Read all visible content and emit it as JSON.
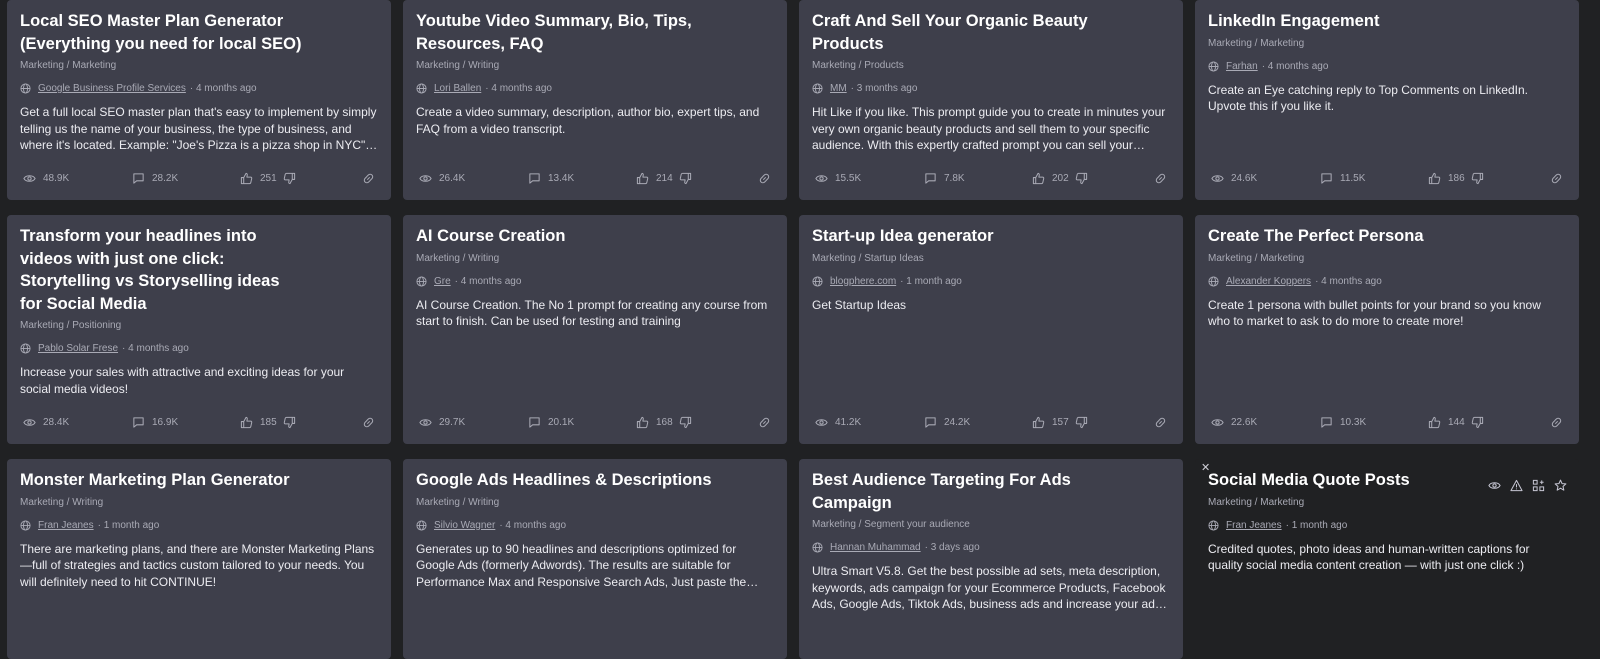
{
  "cards": [
    {
      "title": "Local SEO Master Plan Generator (Everything you need for local SEO)",
      "category": "Marketing / Marketing",
      "author": "Google Business Profile Services",
      "ago": "· 4 months ago",
      "description": "Get a full local SEO master plan that's easy to implement by simply telling us the name of your business, the type of business, and where it's located. Example: \"Joe's Pizza is a pizza shop in NYC\". The master SEO…",
      "views": "48.9K",
      "comments": "28.2K",
      "likes": "251"
    },
    {
      "title": "Youtube Video Summary, Bio, Tips, Resources, FAQ",
      "category": "Marketing / Writing",
      "author": "Lori Ballen",
      "ago": "· 4 months ago",
      "description": "Create a video summary, description, author bio, expert tips, and FAQ from a video transcript.",
      "views": "26.4K",
      "comments": "13.4K",
      "likes": "214"
    },
    {
      "title": "Craft And Sell Your Organic Beauty Products",
      "category": "Marketing / Products",
      "author": "MM",
      "ago": "· 3 months ago",
      "description": "Hit Like if you like. This prompt guide you to create in minutes your very own organic beauty products and sell them to your specific audience. With this expertly crafted prompt you can sell your luxurious skincare,…",
      "views": "15.5K",
      "comments": "7.8K",
      "likes": "202"
    },
    {
      "title": "LinkedIn Engagement",
      "category": "Marketing / Marketing",
      "author": "Farhan",
      "ago": "· 4 months ago",
      "description": "Create an Eye catching reply to Top Comments on LinkedIn. Upvote this if you like it.",
      "views": "24.6K",
      "comments": "11.5K",
      "likes": "186"
    },
    {
      "title": "Transform your headlines into videos with just one click: Storytelling vs Storyselling ideas for Social Media",
      "category": "Marketing / Positioning",
      "author": "Pablo Solar Frese",
      "ago": "· 4 months ago",
      "description": "Increase your sales with attractive and exciting ideas for your social media videos!",
      "views": "28.4K",
      "comments": "16.9K",
      "likes": "185"
    },
    {
      "title": "AI Course Creation",
      "category": "Marketing / Writing",
      "author": "Gre",
      "ago": "· 4 months ago",
      "description": "AI Course Creation. The No 1 prompt for creating any course from start to finish. Can be used for testing and training",
      "views": "29.7K",
      "comments": "20.1K",
      "likes": "168"
    },
    {
      "title": "Start-up Idea generator",
      "category": "Marketing / Startup Ideas",
      "author": "blogphere.com",
      "ago": "· 1 month ago",
      "description": "Get Startup Ideas",
      "views": "41.2K",
      "comments": "24.2K",
      "likes": "157"
    },
    {
      "title": "Create The Perfect Persona",
      "category": "Marketing / Marketing",
      "author": "Alexander Koppers",
      "ago": "· 4 months ago",
      "description": "Create 1 persona with bullet points for your brand so you know who to market to ask to do more to create more!",
      "views": "22.6K",
      "comments": "10.3K",
      "likes": "144"
    },
    {
      "title": "Monster Marketing Plan Generator",
      "category": "Marketing / Writing",
      "author": "Fran Jeanes",
      "ago": "· 1 month ago",
      "description": "There are marketing plans, and there are Monster Marketing Plans—full of strategies and tactics custom tailored to your needs. You will definitely need to hit CONTINUE!",
      "views": "",
      "comments": "",
      "likes": ""
    },
    {
      "title": "Google Ads Headlines & Descriptions",
      "category": "Marketing / Writing",
      "author": "Silvio Wagner",
      "ago": "· 4 months ago",
      "description": "Generates up to 90 headlines and descriptions optimized for Google Ads (formerly Adwords). The results are suitable for Performance Max and Responsive Search Ads, Just paste the topic of your Asset Group a…",
      "views": "",
      "comments": "",
      "likes": ""
    },
    {
      "title": "Best Audience Targeting For Ads Campaign",
      "category": "Marketing / Segment your audience",
      "author": "Hannan Muhammad",
      "ago": "· 3 days ago",
      "description": "Ultra Smart V5.8. Get the best possible ad sets, meta description, keywords, ads campaign for your Ecommerce Products, Facebook Ads, Google Ads, Tiktok Ads, business ads and increase your ad results…",
      "views": "",
      "comments": "",
      "likes": ""
    },
    {
      "title": "Social Media Quote Posts",
      "category": "Marketing / Marketing",
      "author": "Fran Jeanes",
      "ago": "· 1 month ago",
      "description": "Credited quotes, photo ideas and human-written captions for quality social media content creation — with just one click :)",
      "views": "",
      "comments": "",
      "likes": "",
      "close_label": "✕"
    }
  ]
}
